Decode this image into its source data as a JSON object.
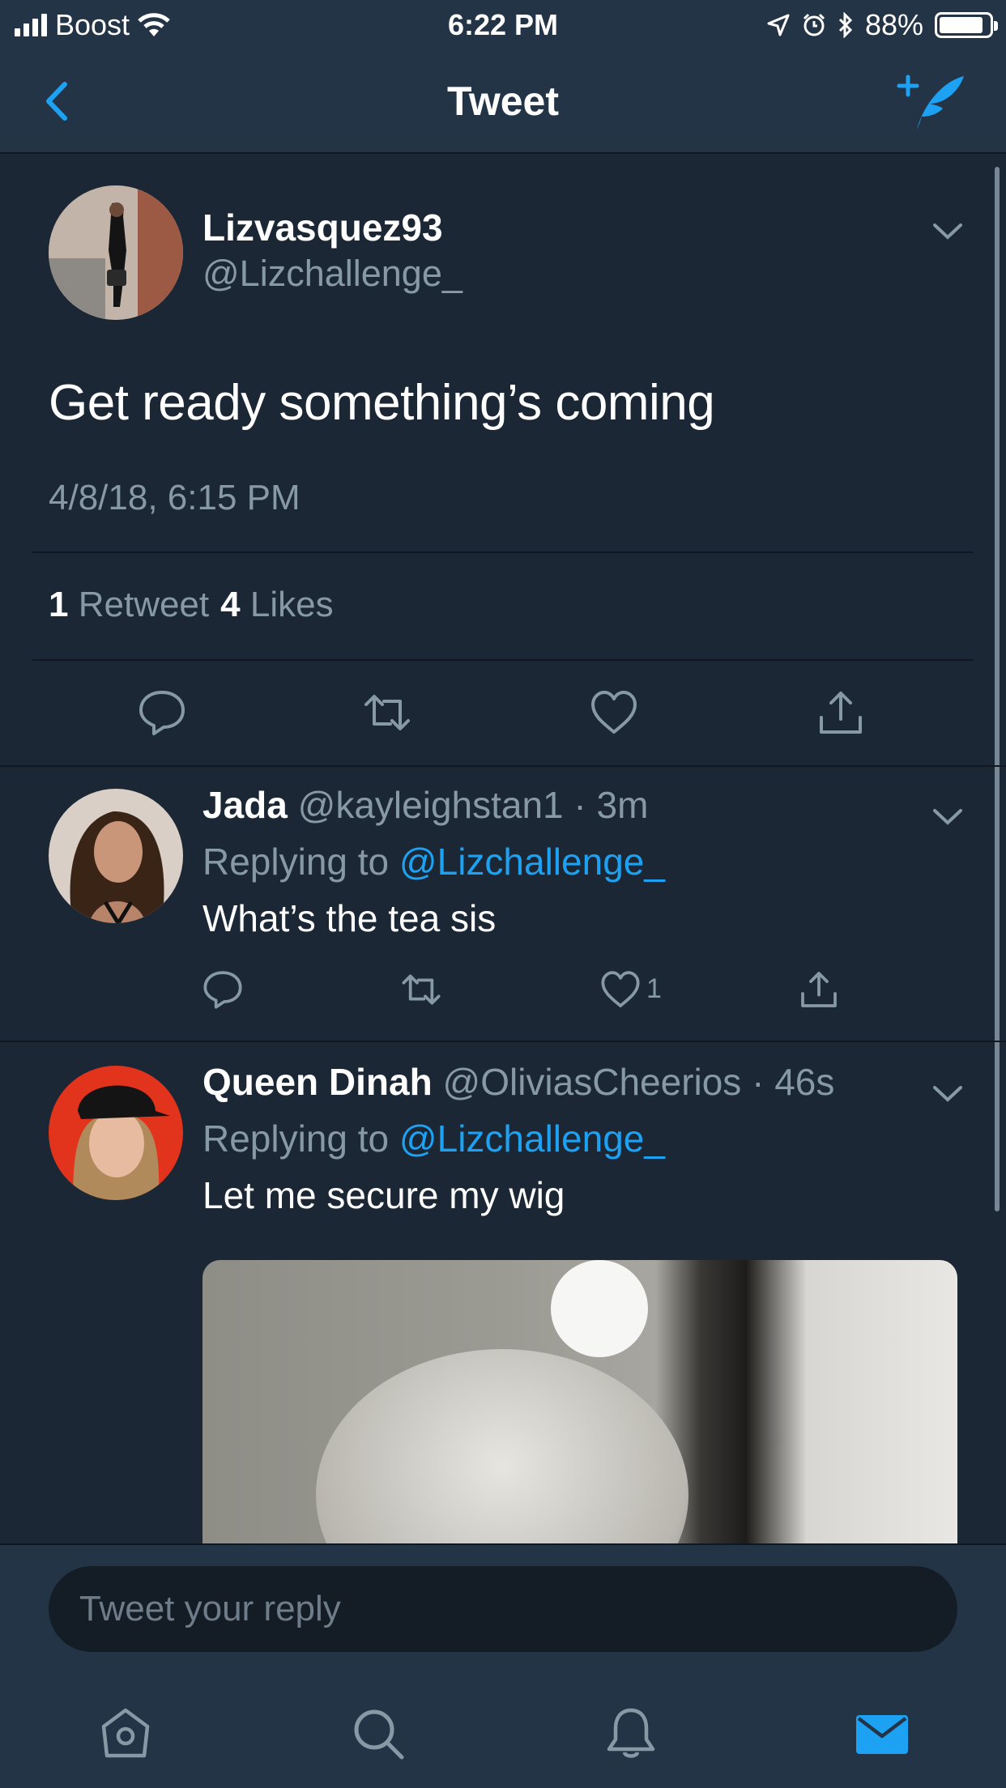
{
  "status_bar": {
    "carrier": "Boost",
    "time": "6:22 PM",
    "battery": "88%",
    "battery_level": 0.88
  },
  "nav": {
    "title": "Tweet"
  },
  "main_tweet": {
    "name": "Lizvasquez93",
    "handle": "@Lizchallenge_",
    "text": "Get ready something’s coming",
    "timestamp": "4/8/18, 6:15 PM",
    "retweet_count": "1",
    "retweet_label": "Retweet",
    "like_count": "4",
    "like_label": "Likes"
  },
  "replies": [
    {
      "name": "Jada",
      "handle": "@kayleighstan1",
      "age": "· 3m",
      "replying_prefix": "Replying to",
      "replying_to": "@Lizchallenge_",
      "text": "What’s the tea sis",
      "like_count": "1"
    },
    {
      "name": "Queen Dinah",
      "handle": "@OliviasCheerios",
      "age": "· 46s",
      "replying_prefix": "Replying to",
      "replying_to": "@Lizchallenge_",
      "text": "Let me secure my wig"
    }
  ],
  "composer": {
    "placeholder": "Tweet your reply"
  },
  "colors": {
    "background": "#1b2735",
    "bar": "#243447",
    "accent": "#1da1f2",
    "muted": "#8899a6"
  },
  "icons": [
    "back-icon",
    "compose-tweet-icon",
    "chevron-down-icon",
    "reply-icon",
    "retweet-icon",
    "like-icon",
    "share-icon",
    "home-icon",
    "search-icon",
    "notifications-icon",
    "messages-icon"
  ]
}
